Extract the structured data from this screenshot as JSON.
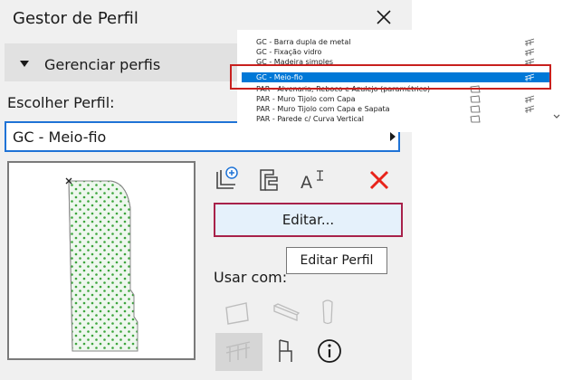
{
  "dialog": {
    "title": "Gestor de Perfil"
  },
  "manage_section": {
    "label": "Gerenciar perfis"
  },
  "choose": {
    "label": "Escolher Perfil:",
    "selected": "GC - Meio-fio"
  },
  "toolbar": {
    "icons": [
      "new-profile-icon",
      "duplicate-profile-icon",
      "rename-profile-icon",
      "delete-profile-icon"
    ],
    "delete_color": "#e8231a"
  },
  "edit_button": {
    "label": "Editar..."
  },
  "tooltip": {
    "text": "Editar Perfil"
  },
  "use_with": {
    "label": "Usar com:",
    "icons": [
      "wall-icon",
      "beam-icon",
      "column-icon",
      "railing-icon",
      "chair-icon",
      "info-icon"
    ]
  },
  "profile_list": {
    "items": [
      {
        "label": "GC - Barra dupla de metal",
        "icon": "railing-icon"
      },
      {
        "label": "GC - Fixação vidro",
        "icon": "railing-icon"
      },
      {
        "label": "GC - Madeira simples",
        "icon": "railing-icon"
      },
      {
        "label": "GC - Meio-fio",
        "icon": "railing-icon",
        "selected": true
      },
      {
        "label": "PAR - Alvenaria, Reboco e Azulejo (paramétrico)",
        "icon": "wall-icon"
      },
      {
        "label": "PAR - Muro Tijolo com Capa",
        "icon": "wall-icon"
      },
      {
        "label": "PAR - Muro Tijolo com Capa e Sapata",
        "icon": "wall-icon"
      },
      {
        "label": "PAR - Parede c/ Curva Vertical",
        "icon": "wall-icon"
      }
    ]
  },
  "colors": {
    "accent": "#1f73d6",
    "highlight_border": "#a8224a",
    "list_selection": "#0078d7",
    "preview_fill": "#3ca53c"
  }
}
